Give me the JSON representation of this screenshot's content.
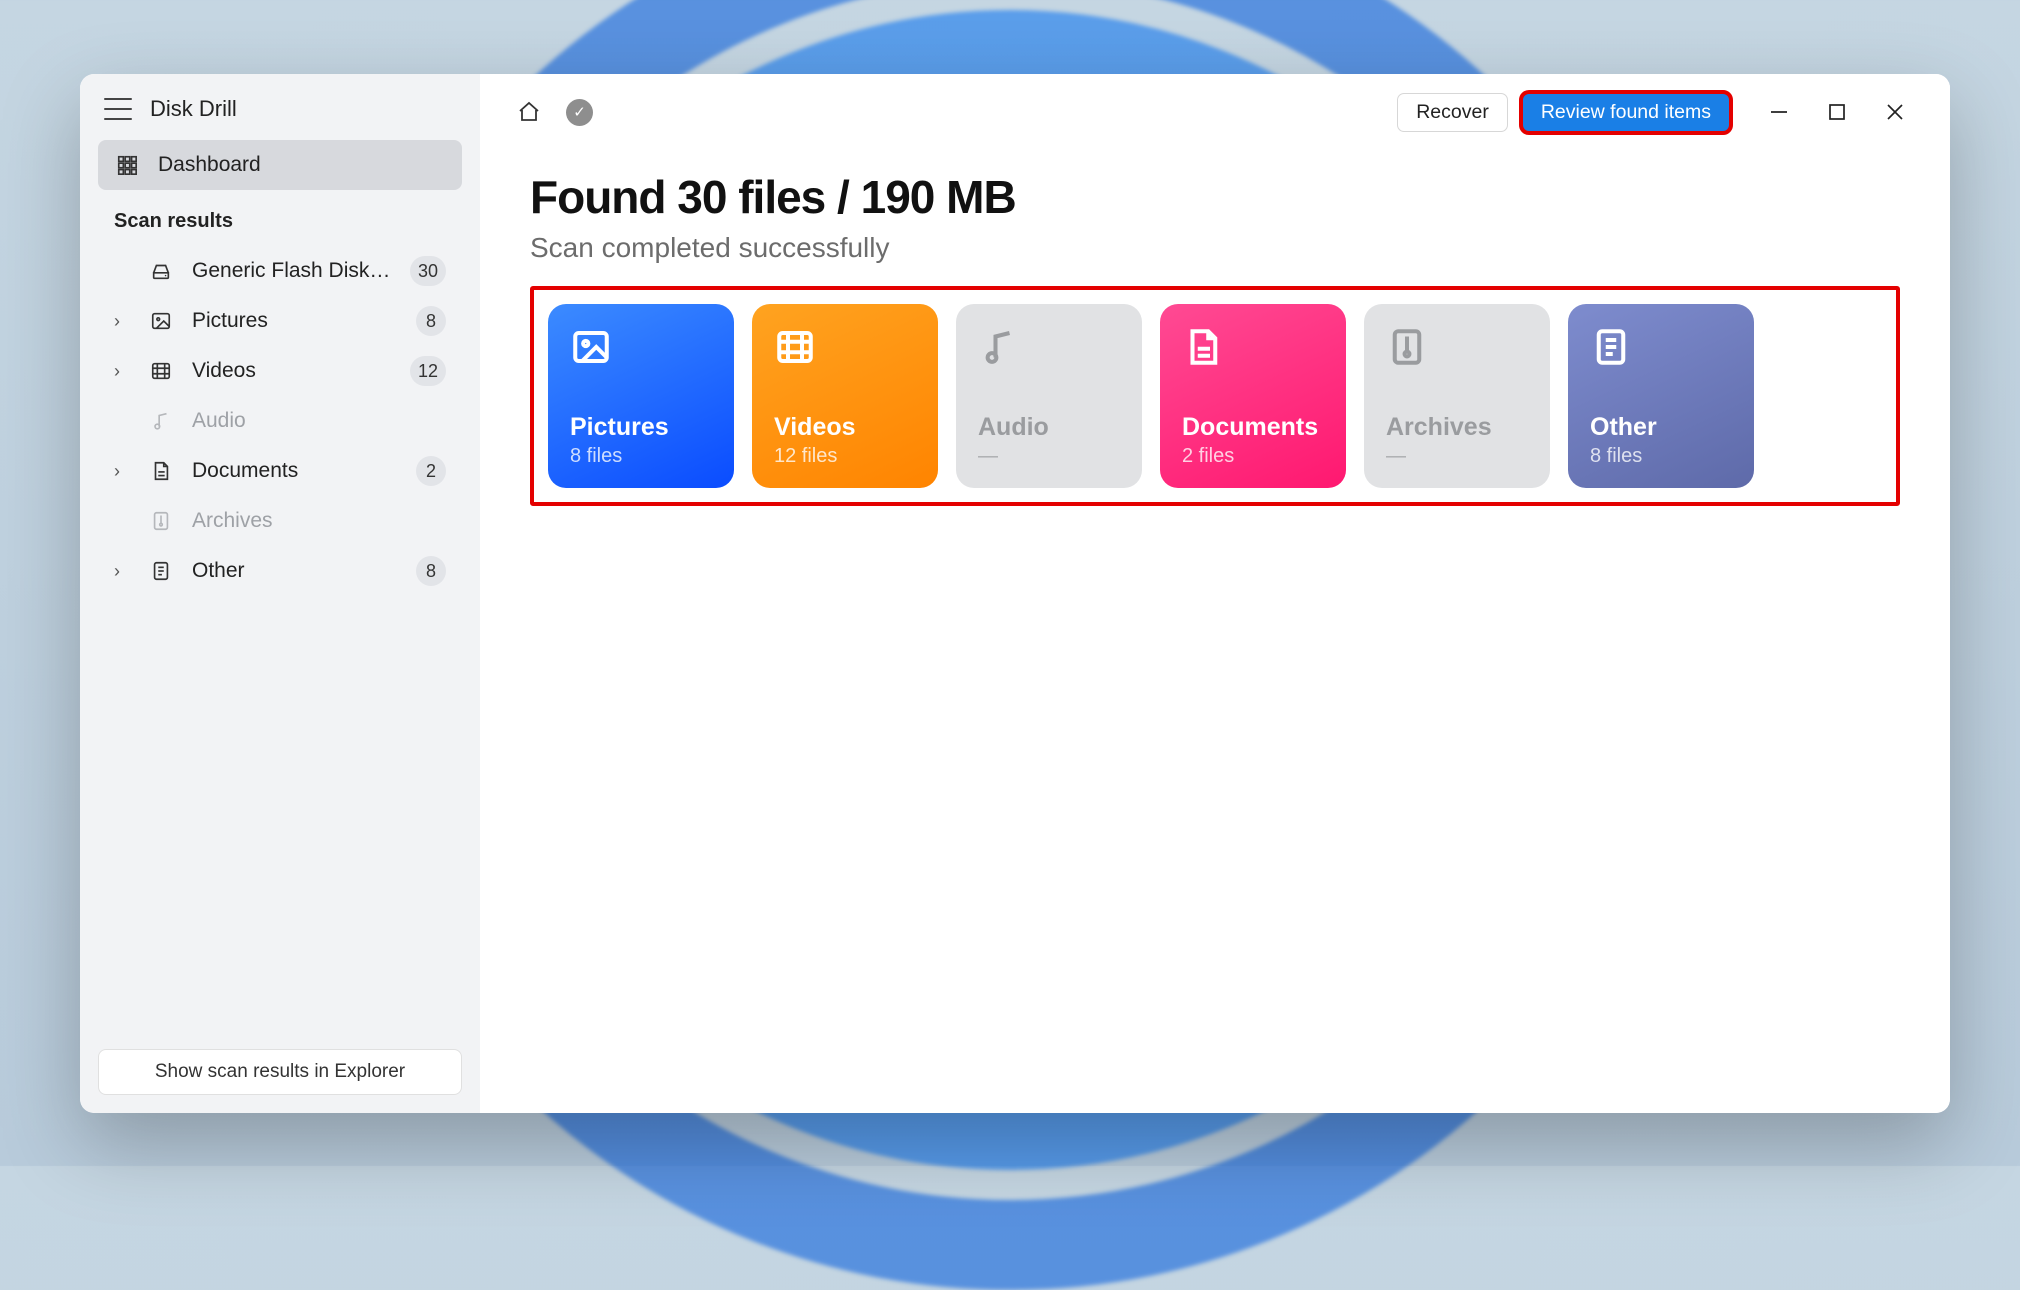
{
  "app_title": "Disk Drill",
  "sidebar": {
    "dashboard": "Dashboard",
    "section_header": "Scan results",
    "items": [
      {
        "label": "Generic Flash Disk USB D...",
        "badge": "30",
        "expandable": false,
        "disabled": false,
        "icon": "drive"
      },
      {
        "label": "Pictures",
        "badge": "8",
        "expandable": true,
        "disabled": false,
        "icon": "image"
      },
      {
        "label": "Videos",
        "badge": "12",
        "expandable": true,
        "disabled": false,
        "icon": "film"
      },
      {
        "label": "Audio",
        "badge": "",
        "expandable": false,
        "disabled": true,
        "icon": "music"
      },
      {
        "label": "Documents",
        "badge": "2",
        "expandable": true,
        "disabled": false,
        "icon": "doc"
      },
      {
        "label": "Archives",
        "badge": "",
        "expandable": false,
        "disabled": true,
        "icon": "zip"
      },
      {
        "label": "Other",
        "badge": "8",
        "expandable": true,
        "disabled": false,
        "icon": "note"
      }
    ],
    "footer_button": "Show scan results in Explorer"
  },
  "toolbar": {
    "recover": "Recover",
    "review": "Review found items"
  },
  "main": {
    "headline": "Found 30 files / 190 MB",
    "subhead": "Scan completed successfully",
    "cards": {
      "pictures": {
        "title": "Pictures",
        "sub": "8 files"
      },
      "videos": {
        "title": "Videos",
        "sub": "12 files"
      },
      "audio": {
        "title": "Audio",
        "sub": "—"
      },
      "documents": {
        "title": "Documents",
        "sub": "2 files"
      },
      "archives": {
        "title": "Archives",
        "sub": "—"
      },
      "other": {
        "title": "Other",
        "sub": "8 files"
      }
    }
  }
}
